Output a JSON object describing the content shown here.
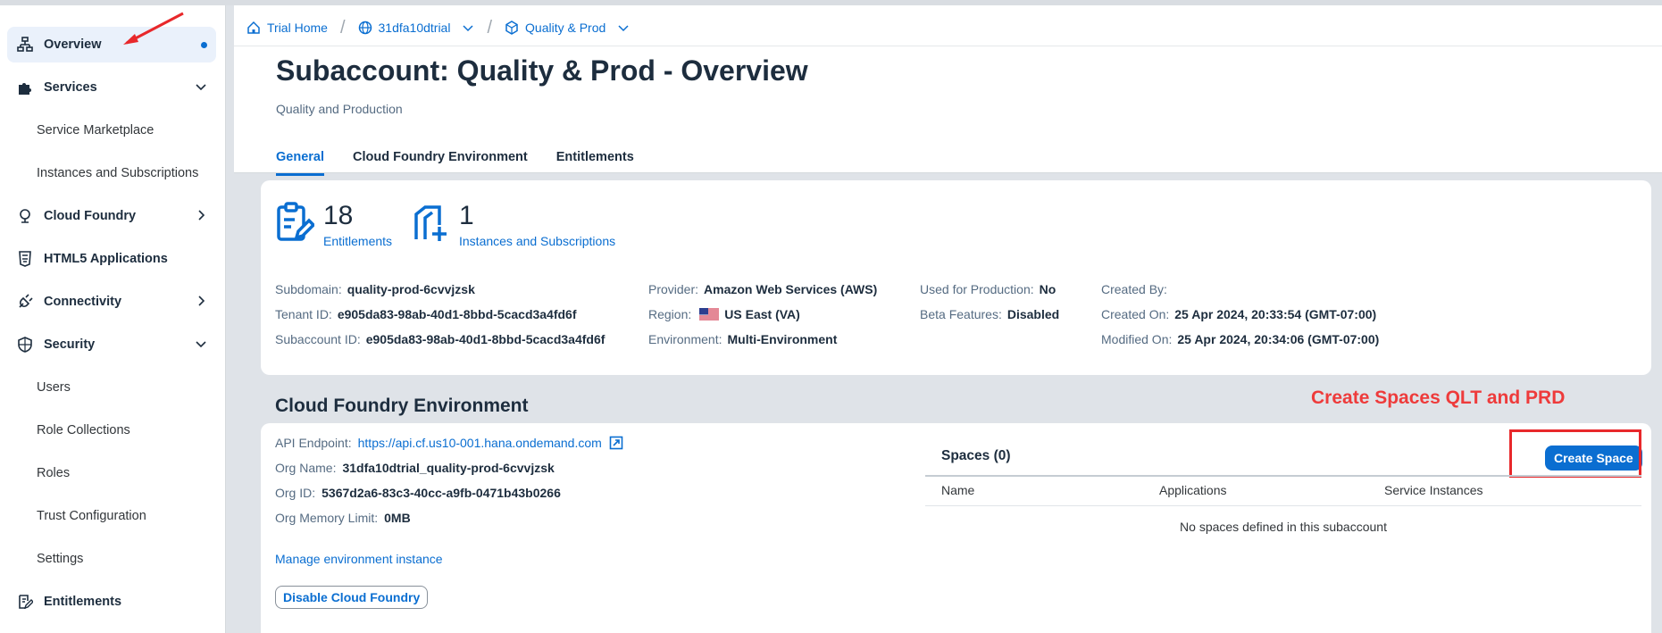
{
  "sidebar": {
    "items": [
      {
        "label": "Overview",
        "active": true
      },
      {
        "label": "Services"
      },
      {
        "label": "Service Marketplace"
      },
      {
        "label": "Instances and Subscriptions"
      },
      {
        "label": "Cloud Foundry"
      },
      {
        "label": "HTML5 Applications"
      },
      {
        "label": "Connectivity"
      },
      {
        "label": "Security"
      },
      {
        "label": "Users"
      },
      {
        "label": "Role Collections"
      },
      {
        "label": "Roles"
      },
      {
        "label": "Trust Configuration"
      },
      {
        "label": "Settings"
      },
      {
        "label": "Entitlements"
      }
    ]
  },
  "breadcrumb": {
    "home": "Trial Home",
    "global_account": "31dfa10dtrial",
    "subaccount": "Quality & Prod"
  },
  "header": {
    "title": "Subaccount: Quality & Prod - Overview",
    "subtitle": "Quality and Production",
    "tabs": [
      "General",
      "Cloud Foundry Environment",
      "Entitlements"
    ]
  },
  "kpis": {
    "entitlements_count": "18",
    "entitlements_label": "Entitlements",
    "instances_count": "1",
    "instances_label": "Instances and Subscriptions"
  },
  "details": {
    "subdomain_label": "Subdomain:",
    "subdomain": "quality-prod-6cvvjzsk",
    "tenant_label": "Tenant ID:",
    "tenant": "e905da83-98ab-40d1-8bbd-5cacd3a4fd6f",
    "subaccount_id_label": "Subaccount ID:",
    "subaccount_id": "e905da83-98ab-40d1-8bbd-5cacd3a4fd6f",
    "provider_label": "Provider:",
    "provider": "Amazon Web Services (AWS)",
    "region_label": "Region:",
    "region": "US East (VA)",
    "environment_label": "Environment:",
    "environment": "Multi-Environment",
    "production_label": "Used for Production:",
    "production": "No",
    "beta_label": "Beta Features:",
    "beta": "Disabled",
    "created_by_label": "Created By:",
    "created_on_label": "Created On:",
    "created_on": "25 Apr 2024, 20:33:54 (GMT-07:00)",
    "modified_on_label": "Modified On:",
    "modified_on": "25 Apr 2024, 20:34:06 (GMT-07:00)"
  },
  "cf": {
    "section_title": "Cloud Foundry Environment",
    "api_label": "API Endpoint:",
    "api": "https://api.cf.us10-001.hana.ondemand.com",
    "org_name_label": "Org Name:",
    "org_name": "31dfa10dtrial_quality-prod-6cvvjzsk",
    "org_id_label": "Org ID:",
    "org_id": "5367d2a6-83c3-40cc-a9fb-0471b43b0266",
    "memory_label": "Org Memory Limit:",
    "memory": "0MB",
    "manage_link": "Manage environment instance",
    "disable_button": "Disable Cloud Foundry"
  },
  "spaces": {
    "title": "Spaces (0)",
    "create_button": "Create Space",
    "columns": [
      "Name",
      "Applications",
      "Service Instances"
    ],
    "empty_text": "No spaces defined in this subaccount"
  },
  "annotation": {
    "text": "Create Spaces QLT and PRD",
    "color": "#ee3b3b"
  },
  "colors": {
    "accent": "#0a6ed1",
    "annotation_red": "#e8282b"
  }
}
